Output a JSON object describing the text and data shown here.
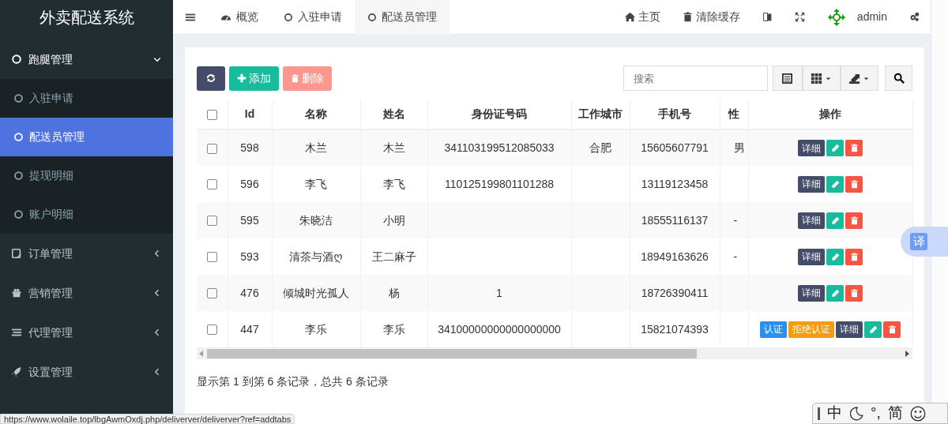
{
  "app_title": "外卖配送系统",
  "sidebar": {
    "items": [
      {
        "label": "跑腿管理",
        "expanded": true,
        "children": [
          {
            "label": "入驻申请",
            "selected": false
          },
          {
            "label": "配送员管理",
            "selected": true
          },
          {
            "label": "提现明细",
            "selected": false
          },
          {
            "label": "账户明细",
            "selected": false
          }
        ]
      },
      {
        "label": "订单管理",
        "expanded": false
      },
      {
        "label": "营销管理",
        "expanded": false
      },
      {
        "label": "代理管理",
        "expanded": false
      },
      {
        "label": "设置管理",
        "expanded": false
      }
    ]
  },
  "tabs": [
    {
      "label": "概览",
      "selected": false
    },
    {
      "label": "入驻申请",
      "selected": false
    },
    {
      "label": "配送员管理",
      "selected": true
    }
  ],
  "nav_right": {
    "home": "主页",
    "clear_cache": "清除缓存",
    "user": "admin"
  },
  "toolbar": {
    "buttons": [
      {
        "kind": "refresh",
        "disabled": false
      },
      {
        "kind": "add",
        "label": "添加",
        "disabled": false
      },
      {
        "kind": "delete",
        "label": "删除",
        "disabled": true
      }
    ],
    "search": {
      "placeholder": "搜索"
    }
  },
  "table": {
    "select_all_checked": false,
    "columns": [
      "Id",
      "名称",
      "姓名",
      "身份证号码",
      "工作城市",
      "手机号",
      "性",
      "操作"
    ],
    "rows": [
      {
        "checked": false,
        "cells": [
          "598",
          "木兰",
          "木兰",
          "341103199512085033",
          "合肥",
          "15605607791",
          "男"
        ],
        "actions": [
          {
            "kind": "detail",
            "label": "详细"
          },
          {
            "kind": "edit"
          },
          {
            "kind": "delete"
          }
        ]
      },
      {
        "checked": false,
        "cells": [
          "596",
          "李飞",
          "李飞",
          "110125199801101288",
          "",
          "13119123458",
          ""
        ],
        "actions": [
          {
            "kind": "detail",
            "label": "详细"
          },
          {
            "kind": "edit"
          },
          {
            "kind": "delete"
          }
        ]
      },
      {
        "checked": false,
        "cells": [
          "595",
          "朱晓洁",
          "小明",
          "",
          "",
          "18555116137",
          "-"
        ],
        "actions": [
          {
            "kind": "detail",
            "label": "详细"
          },
          {
            "kind": "edit"
          },
          {
            "kind": "delete"
          }
        ]
      },
      {
        "checked": false,
        "cells": [
          "593",
          "清茶与酒ღ",
          "王二麻子",
          "",
          "",
          "18949163626",
          "-"
        ],
        "actions": [
          {
            "kind": "detail",
            "label": "详细"
          },
          {
            "kind": "edit"
          },
          {
            "kind": "delete"
          }
        ]
      },
      {
        "checked": false,
        "cells": [
          "476",
          "倾城时光孤人",
          "杨",
          "1",
          "",
          "18726390411",
          ""
        ],
        "actions": [
          {
            "kind": "detail",
            "label": "详细"
          },
          {
            "kind": "edit"
          },
          {
            "kind": "delete"
          }
        ]
      },
      {
        "checked": false,
        "cells": [
          "447",
          "李乐",
          "李乐",
          "34100000000000000000",
          "",
          "15821074393",
          ""
        ],
        "actions": [
          {
            "kind": "verify",
            "label": "认证"
          },
          {
            "kind": "reject",
            "label": "拒绝认证"
          },
          {
            "kind": "detail",
            "label": "详细"
          },
          {
            "kind": "edit"
          },
          {
            "kind": "delete"
          }
        ]
      }
    ]
  },
  "pagination_info": "显示第 1 到第 6 条记录，总共 6 条记录",
  "translate_button": "译",
  "status_url": "https://www.wolaile.top/lbgAwmOxdj.php/deliverver/deliverver?ref=addtabs",
  "ime_bar": [
    "中",
    "°,",
    "简"
  ]
}
